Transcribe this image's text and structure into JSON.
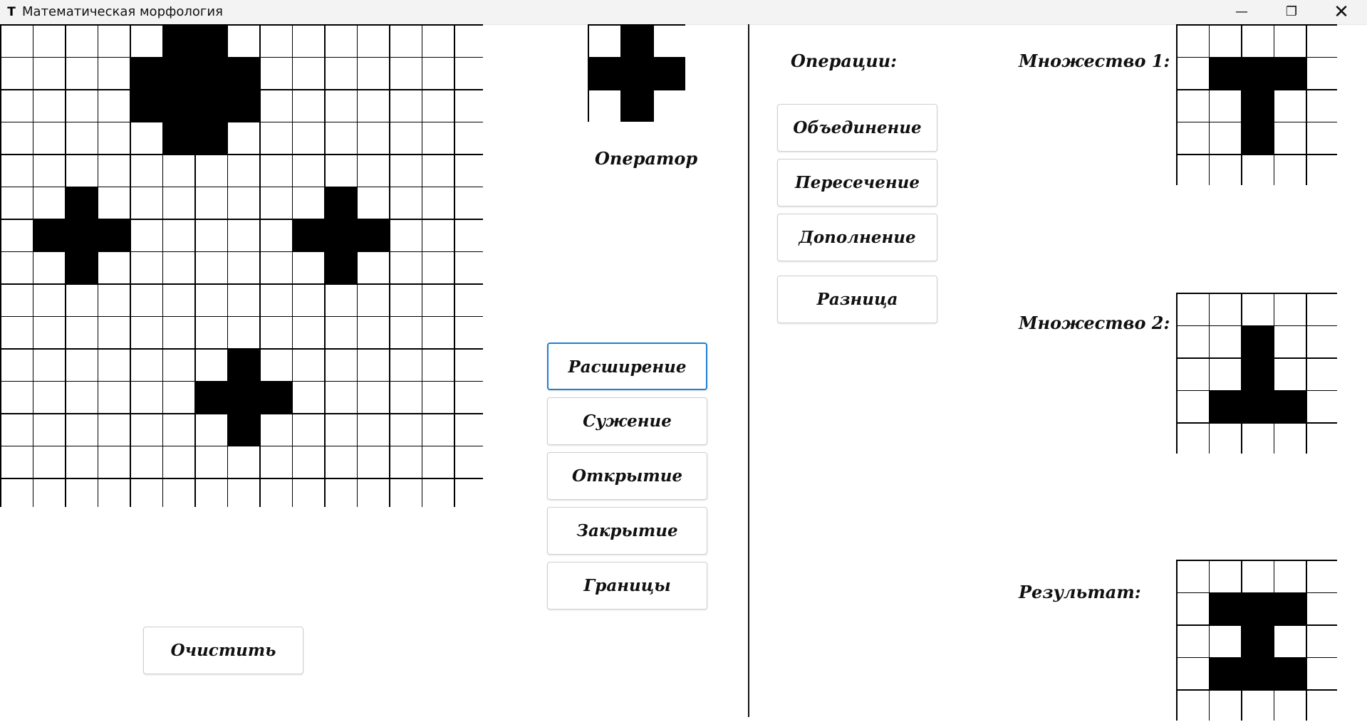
{
  "window": {
    "title": "Математическая морфология",
    "icon": "T-app-icon",
    "controls": {
      "minimize": "—",
      "maximize": "❐",
      "close": "✕"
    }
  },
  "canvas": {
    "rows": 15,
    "cols": 15,
    "filled": [
      [
        0,
        5
      ],
      [
        0,
        6
      ],
      [
        1,
        4
      ],
      [
        1,
        5
      ],
      [
        1,
        6
      ],
      [
        1,
        7
      ],
      [
        2,
        4
      ],
      [
        2,
        5
      ],
      [
        2,
        6
      ],
      [
        2,
        7
      ],
      [
        3,
        5
      ],
      [
        3,
        6
      ],
      [
        5,
        2
      ],
      [
        5,
        10
      ],
      [
        6,
        1
      ],
      [
        6,
        2
      ],
      [
        6,
        3
      ],
      [
        6,
        9
      ],
      [
        6,
        10
      ],
      [
        6,
        11
      ],
      [
        7,
        2
      ],
      [
        7,
        10
      ],
      [
        10,
        7
      ],
      [
        11,
        6
      ],
      [
        11,
        7
      ],
      [
        11,
        8
      ],
      [
        12,
        7
      ]
    ]
  },
  "operator": {
    "label": "Оператор",
    "rows": 3,
    "cols": 3,
    "filled": [
      [
        0,
        1
      ],
      [
        1,
        0
      ],
      [
        1,
        1
      ],
      [
        1,
        2
      ],
      [
        2,
        1
      ]
    ]
  },
  "morphology_buttons": [
    "Расширение",
    "Сужение",
    "Открытие",
    "Закрытие",
    "Границы"
  ],
  "clear_button": "Очистить",
  "operations": {
    "label": "Операции:",
    "buttons": [
      "Объединение",
      "Пересечение",
      "Дополнение",
      "Разница"
    ]
  },
  "set1": {
    "label": "Множество 1:",
    "rows": 5,
    "cols": 5,
    "filled": [
      [
        1,
        1
      ],
      [
        1,
        2
      ],
      [
        1,
        3
      ],
      [
        2,
        2
      ],
      [
        3,
        2
      ]
    ]
  },
  "set2": {
    "label": "Множество 2:",
    "rows": 5,
    "cols": 5,
    "filled": [
      [
        1,
        2
      ],
      [
        2,
        2
      ],
      [
        3,
        1
      ],
      [
        3,
        2
      ],
      [
        3,
        3
      ]
    ]
  },
  "result": {
    "label": "Результат:",
    "rows": 5,
    "cols": 5,
    "filled": [
      [
        1,
        1
      ],
      [
        1,
        2
      ],
      [
        1,
        3
      ],
      [
        2,
        2
      ],
      [
        3,
        1
      ],
      [
        3,
        2
      ],
      [
        3,
        3
      ]
    ]
  }
}
